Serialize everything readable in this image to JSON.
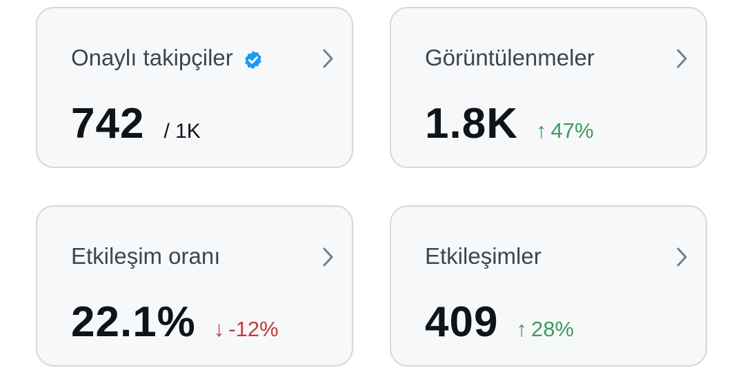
{
  "colors": {
    "card_bg": "#f7f8f9",
    "card_border": "#cfd9de",
    "title_text": "#3a4651",
    "value_text": "#0f1419",
    "positive": "#3c9a5f",
    "negative": "#c4393f",
    "verified": "#1d9bf0",
    "chevron": "#6e7f8d"
  },
  "cards": [
    {
      "title": "Onaylı takipçiler",
      "icon": "verified-badge-icon",
      "value": "742",
      "secondary": "/ 1K"
    },
    {
      "title": "Görüntülenmeler",
      "value": "1.8K",
      "change": {
        "arrow": "↑",
        "text": "47%",
        "direction": "up"
      }
    },
    {
      "title": "Etkileşim oranı",
      "value": "22.1%",
      "change": {
        "arrow": "↓",
        "text": "-12%",
        "direction": "down"
      }
    },
    {
      "title": "Etkileşimler",
      "value": "409",
      "change": {
        "arrow": "↑",
        "text": "28%",
        "direction": "up"
      }
    }
  ]
}
